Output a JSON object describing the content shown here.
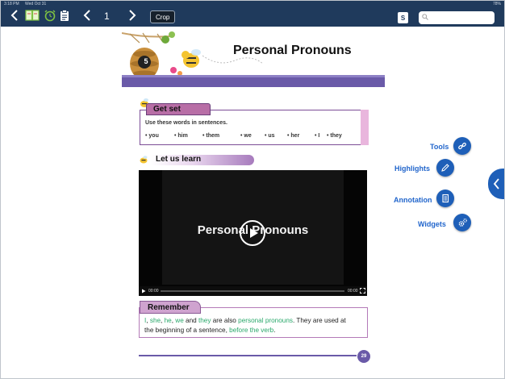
{
  "status": {
    "time": "3:18 PM",
    "date": "Wed Oct 31",
    "battery": "78%"
  },
  "toolbar": {
    "page_number": "1",
    "crop_label": "Crop",
    "s_badge": "S",
    "search_placeholder": ""
  },
  "page": {
    "unit_number": "5",
    "title": "Personal Pronouns",
    "get_set": {
      "heading": "Get set",
      "instruction": "Use these words in sentences.",
      "words": [
        "• you",
        "• him",
        "• them",
        "• we",
        "• us",
        "• her",
        "• I",
        "• they"
      ]
    },
    "learn_heading": "Let us learn",
    "video": {
      "title": "Personal Pronouns",
      "time_current": "00:00",
      "time_total": "00:00"
    },
    "remember": {
      "heading": "Remember",
      "line1_parts": [
        "I",
        ", ",
        "she",
        ", ",
        "he",
        ", ",
        "we",
        " and ",
        "they",
        " are also ",
        "personal pronouns",
        ". They are used at"
      ],
      "line2_parts": [
        "the beginning of a sentence, ",
        "before the verb",
        "."
      ]
    },
    "page_badge": "29"
  },
  "tools": [
    {
      "label": "Tools",
      "icon": "link-icon"
    },
    {
      "label": "Highlights",
      "icon": "pencil-icon"
    },
    {
      "label": "Annotation",
      "icon": "notes-icon"
    },
    {
      "label": "Widgets",
      "icon": "gears-icon"
    }
  ],
  "colors": {
    "topbar": "#1f3a5c",
    "accent_blue": "#1e5fb8",
    "purple": "#6a5aa8",
    "green_text": "#2aa86b"
  }
}
